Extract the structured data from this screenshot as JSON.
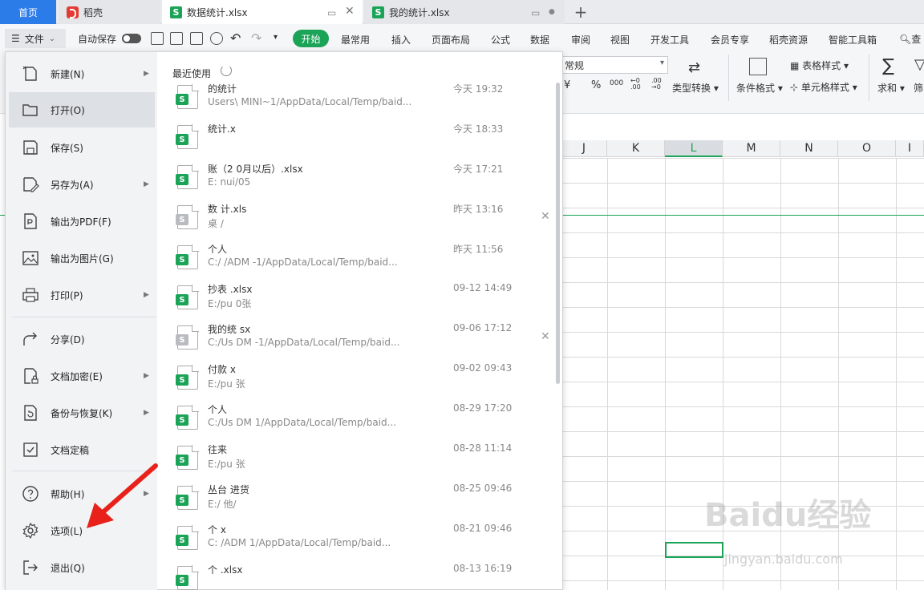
{
  "tabs": {
    "home": "首页",
    "daoke": "稻壳",
    "active": "数据统计.xlsx",
    "other": "我的统计.xlsx",
    "new_tab": "+"
  },
  "ribbon": {
    "file": "文件",
    "autosave": "自动保存",
    "start": "开始",
    "items": [
      "最常用",
      "插入",
      "页面布局",
      "公式",
      "数据",
      "审阅",
      "视图",
      "开发工具",
      "会员专享",
      "稻壳资源",
      "智能工具箱"
    ],
    "search": "查"
  },
  "toolbar": {
    "number_format": "常规",
    "currency": "¥",
    "percent": "%",
    "thousands": "000",
    "inc_dec": "←0 .00",
    "dec_dec": ".00 →0",
    "type_convert": "类型转换",
    "cond_format": "条件格式",
    "table_style": "表格样式",
    "cell_style": "单元格样式",
    "sum": "求和",
    "filter": "筛"
  },
  "columns": [
    "J",
    "K",
    "L",
    "M",
    "N",
    "O",
    "I"
  ],
  "file_menu": {
    "items": [
      {
        "label": "新建(N)",
        "arrow": true
      },
      {
        "label": "打开(O)",
        "arrow": false
      },
      {
        "label": "保存(S)",
        "arrow": false
      },
      {
        "label": "另存为(A)",
        "arrow": true
      },
      {
        "label": "输出为PDF(F)",
        "arrow": false
      },
      {
        "label": "输出为图片(G)",
        "arrow": false
      },
      {
        "label": "打印(P)",
        "arrow": true
      },
      {
        "label": "分享(D)",
        "arrow": false
      },
      {
        "label": "文档加密(E)",
        "arrow": true
      },
      {
        "label": "备份与恢复(K)",
        "arrow": true
      },
      {
        "label": "文档定稿",
        "arrow": false
      },
      {
        "label": "帮助(H)",
        "arrow": true
      },
      {
        "label": "选项(L)",
        "arrow": false
      },
      {
        "label": "退出(Q)",
        "arrow": false
      }
    ],
    "recent_title": "最近使用",
    "recent": [
      {
        "name": "的统计",
        "path": "Users\\ MINI~1/AppData/Local/Temp/baid...",
        "time": "今天 19:32",
        "grey": false,
        "close": false
      },
      {
        "name": "统计.x",
        "path": "",
        "time": "今天 18:33",
        "grey": false,
        "close": false
      },
      {
        "name": "账（2 0月以后）.xlsx",
        "path": "E: nui/05",
        "time": "今天 17:21",
        "grey": false,
        "close": false
      },
      {
        "name": "数 计.xls",
        "path": "桌 /",
        "time": "昨天 13:16",
        "grey": true,
        "close": true
      },
      {
        "name": "个人",
        "path": "C:/ /ADM -1/AppData/Local/Temp/baid...",
        "time": "昨天 11:56",
        "grey": false,
        "close": false
      },
      {
        "name": "抄表 .xlsx",
        "path": "E:/pu 0张",
        "time": "09-12 14:49",
        "grey": false,
        "close": false
      },
      {
        "name": "我的统 sx",
        "path": "C:/Us DM -1/AppData/Local/Temp/baid...",
        "time": "09-06 17:12",
        "grey": true,
        "close": true
      },
      {
        "name": "付款 x",
        "path": "E:/pu 张",
        "time": "09-02 09:43",
        "grey": false,
        "close": false
      },
      {
        "name": "个人",
        "path": "C:/Us DM 1/AppData/Local/Temp/baid...",
        "time": "08-29 17:20",
        "grey": false,
        "close": false
      },
      {
        "name": "往来",
        "path": "E:/pu 张",
        "time": "08-28 11:14",
        "grey": false,
        "close": false
      },
      {
        "name": "丛台 进货",
        "path": "E:/ 他/",
        "time": "08-25 09:46",
        "grey": false,
        "close": false
      },
      {
        "name": "个 x",
        "path": "C: /ADM 1/AppData/Local/Temp/baid...",
        "time": "08-21 09:46",
        "grey": false,
        "close": false
      },
      {
        "name": "个 .xlsx",
        "path": "",
        "time": "08-13 16:19",
        "grey": false,
        "close": false
      }
    ]
  },
  "watermark": {
    "brand": "Baidu经验",
    "url": "jingyan.baidu.com"
  },
  "colors": {
    "accent": "#1ba357",
    "home_tab": "#2b7be9",
    "annotation": "#e8211b"
  }
}
